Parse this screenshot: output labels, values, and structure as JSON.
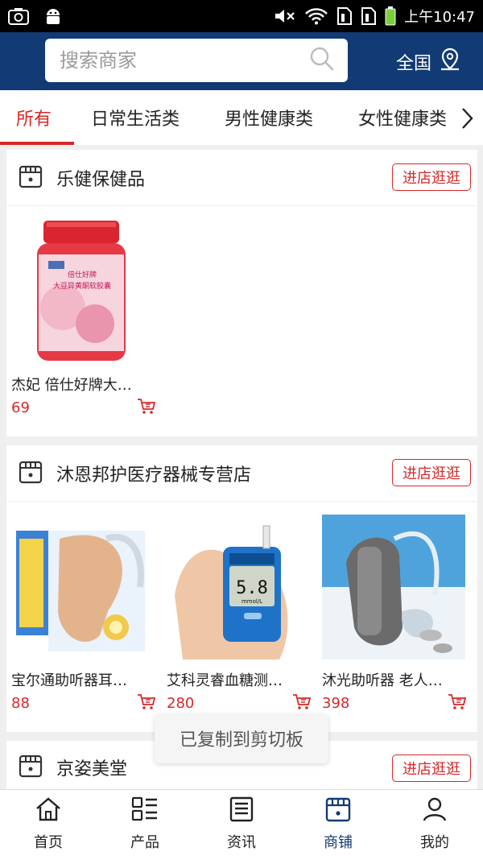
{
  "status_bar": {
    "time": "上午10:47"
  },
  "header": {
    "search_placeholder": "搜索商家",
    "region": "全国"
  },
  "tabs": [
    {
      "label": "所有"
    },
    {
      "label": "日常生活类"
    },
    {
      "label": "男性健康类"
    },
    {
      "label": "女性健康类"
    }
  ],
  "stores": [
    {
      "name": "乐健保健品",
      "enter": "进店逛逛",
      "products": [
        {
          "name": "杰妃 倍仕好牌大…",
          "price": "69"
        }
      ]
    },
    {
      "name": "沐恩邦护医疗器械专营店",
      "enter": "进店逛逛",
      "products": [
        {
          "name": "宝尔通助听器耳…",
          "price": "88"
        },
        {
          "name": "艾科灵睿血糖测…",
          "price": "280"
        },
        {
          "name": "沐光助听器 老人…",
          "price": "398"
        }
      ]
    },
    {
      "name": "京姿美堂",
      "enter": "进店逛逛"
    }
  ],
  "product_image_text": {
    "bottle_label": "倍仕好牌",
    "bottle_sub": "大豆异黄酮软胶囊",
    "meter_reading": "5.8",
    "meter_unit": "mmol/L"
  },
  "toast": "已复制到剪切板",
  "bottom_nav": [
    {
      "label": "首页"
    },
    {
      "label": "产品"
    },
    {
      "label": "资讯"
    },
    {
      "label": "商铺"
    },
    {
      "label": "我的"
    }
  ]
}
